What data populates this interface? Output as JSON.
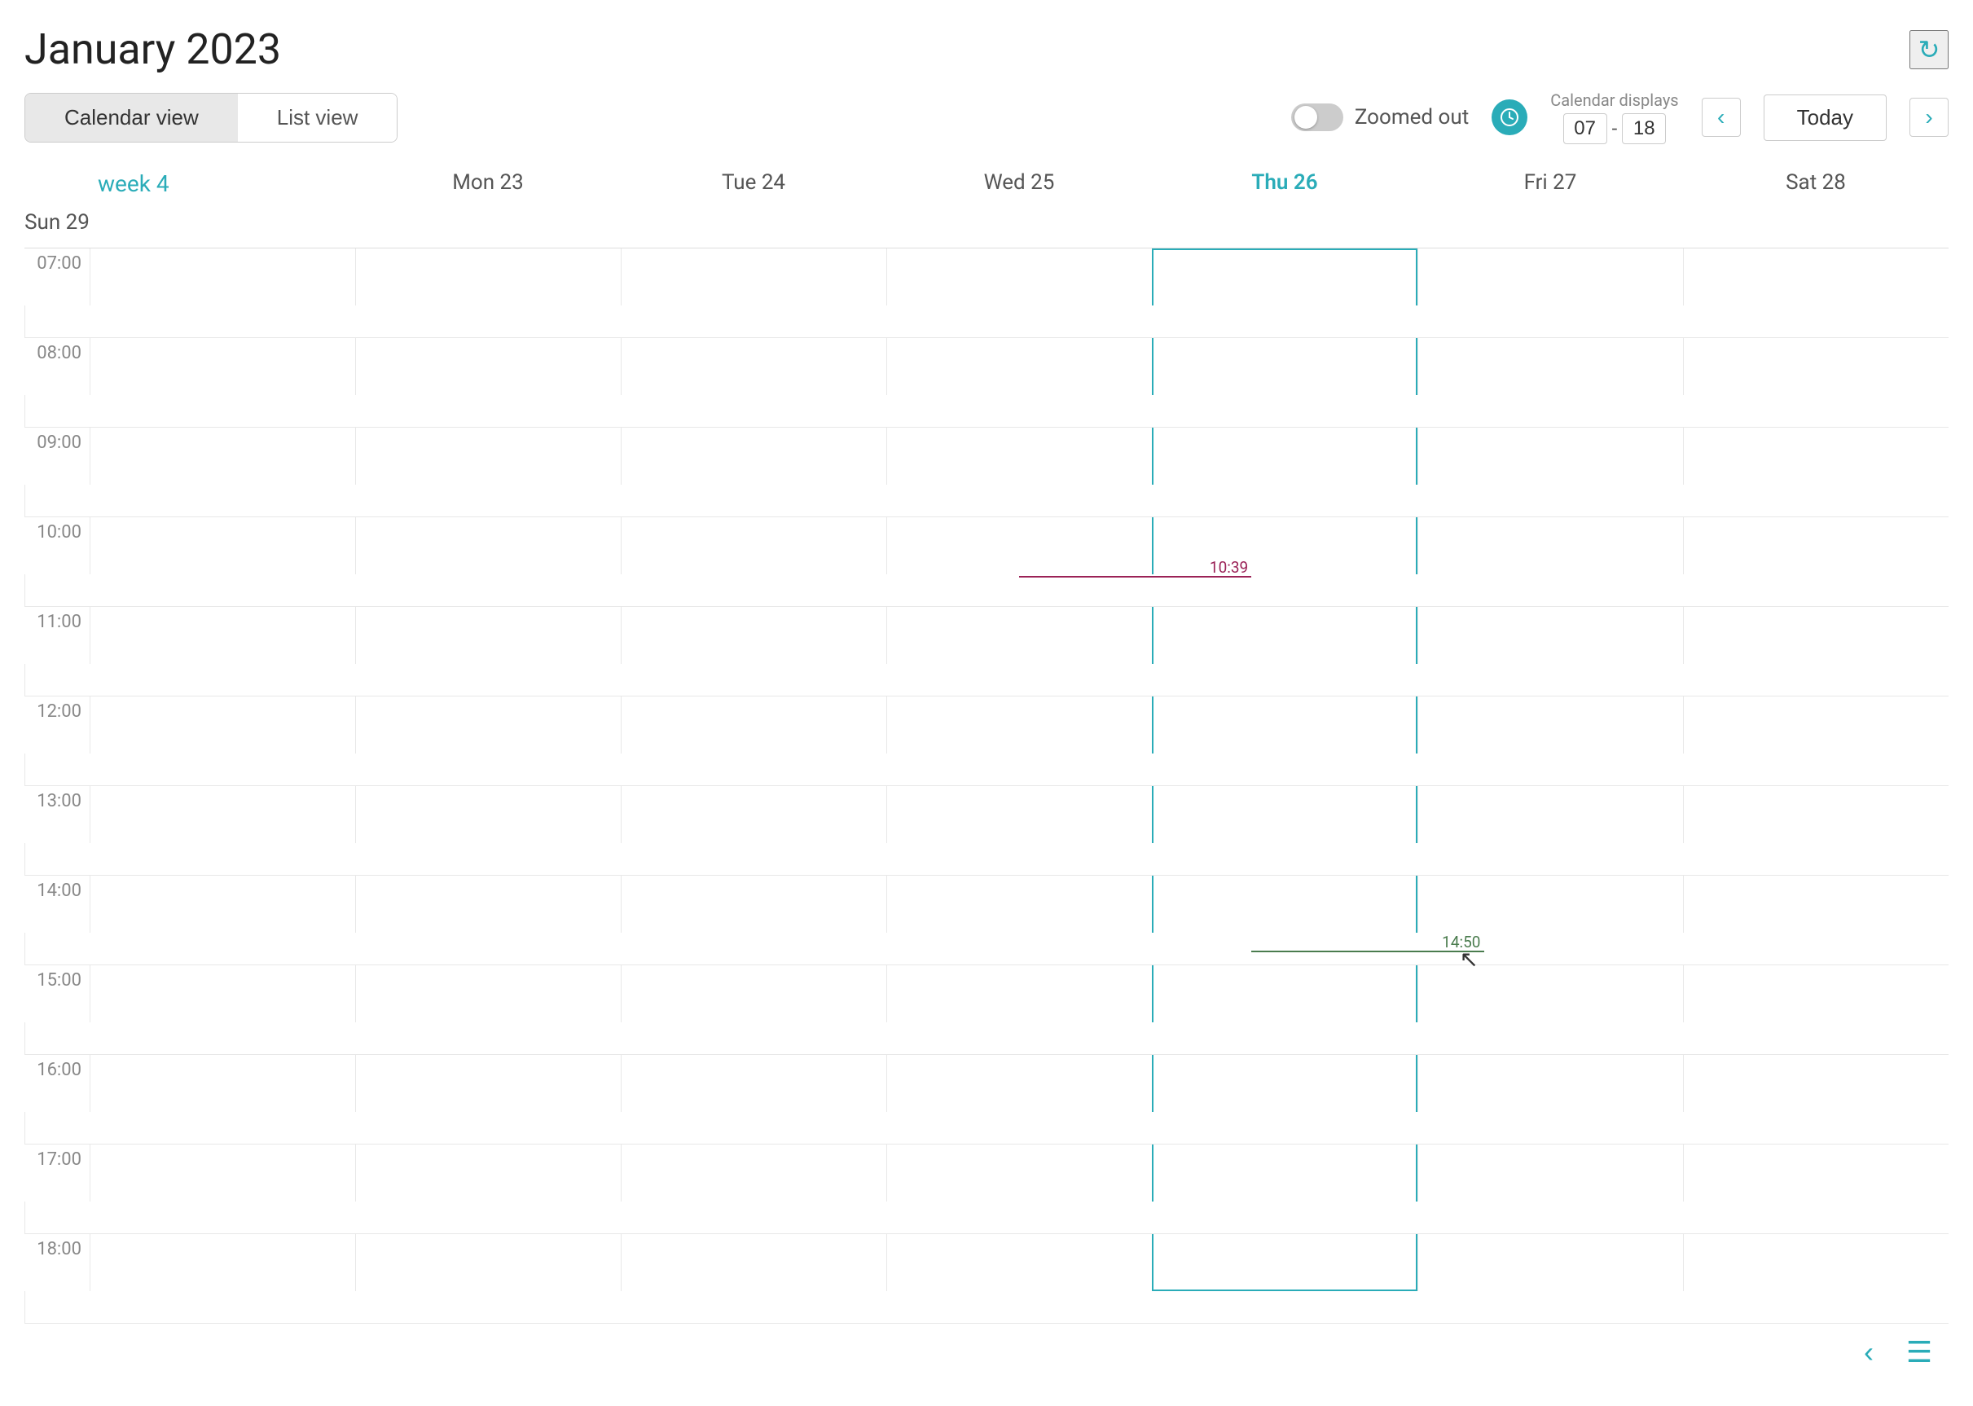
{
  "header": {
    "title": "January 2023",
    "refresh_label": "↻"
  },
  "toolbar": {
    "calendar_view_label": "Calendar view",
    "list_view_label": "List view",
    "zoom_label": "Zoomed out",
    "calendar_displays_label": "Calendar displays",
    "time_from": "07",
    "time_to": "18",
    "today_label": "Today",
    "nav_prev": "‹",
    "nav_next": "›"
  },
  "day_headers": [
    {
      "label": "week 4",
      "is_week": true
    },
    {
      "label": "Mon 23",
      "is_today": false
    },
    {
      "label": "Tue 24",
      "is_today": false
    },
    {
      "label": "Wed 25",
      "is_today": false
    },
    {
      "label": "Thu 26",
      "is_today": true
    },
    {
      "label": "Fri 27",
      "is_today": false
    },
    {
      "label": "Sat 28",
      "is_today": false
    },
    {
      "label": "Sun 29",
      "is_today": false
    }
  ],
  "hours": [
    "07:00",
    "08:00",
    "09:00",
    "10:00",
    "11:00",
    "12:00",
    "13:00",
    "14:00",
    "15:00",
    "16:00",
    "17:00",
    "18:00"
  ],
  "indicators": {
    "thu_time": "10:39",
    "fri_time": "14:50"
  },
  "bottom_icons": {
    "left_label": "‹",
    "list_label": "☰"
  },
  "colors": {
    "teal": "#2aacb8",
    "maroon": "#9b2257",
    "green": "#4a7c4e"
  }
}
